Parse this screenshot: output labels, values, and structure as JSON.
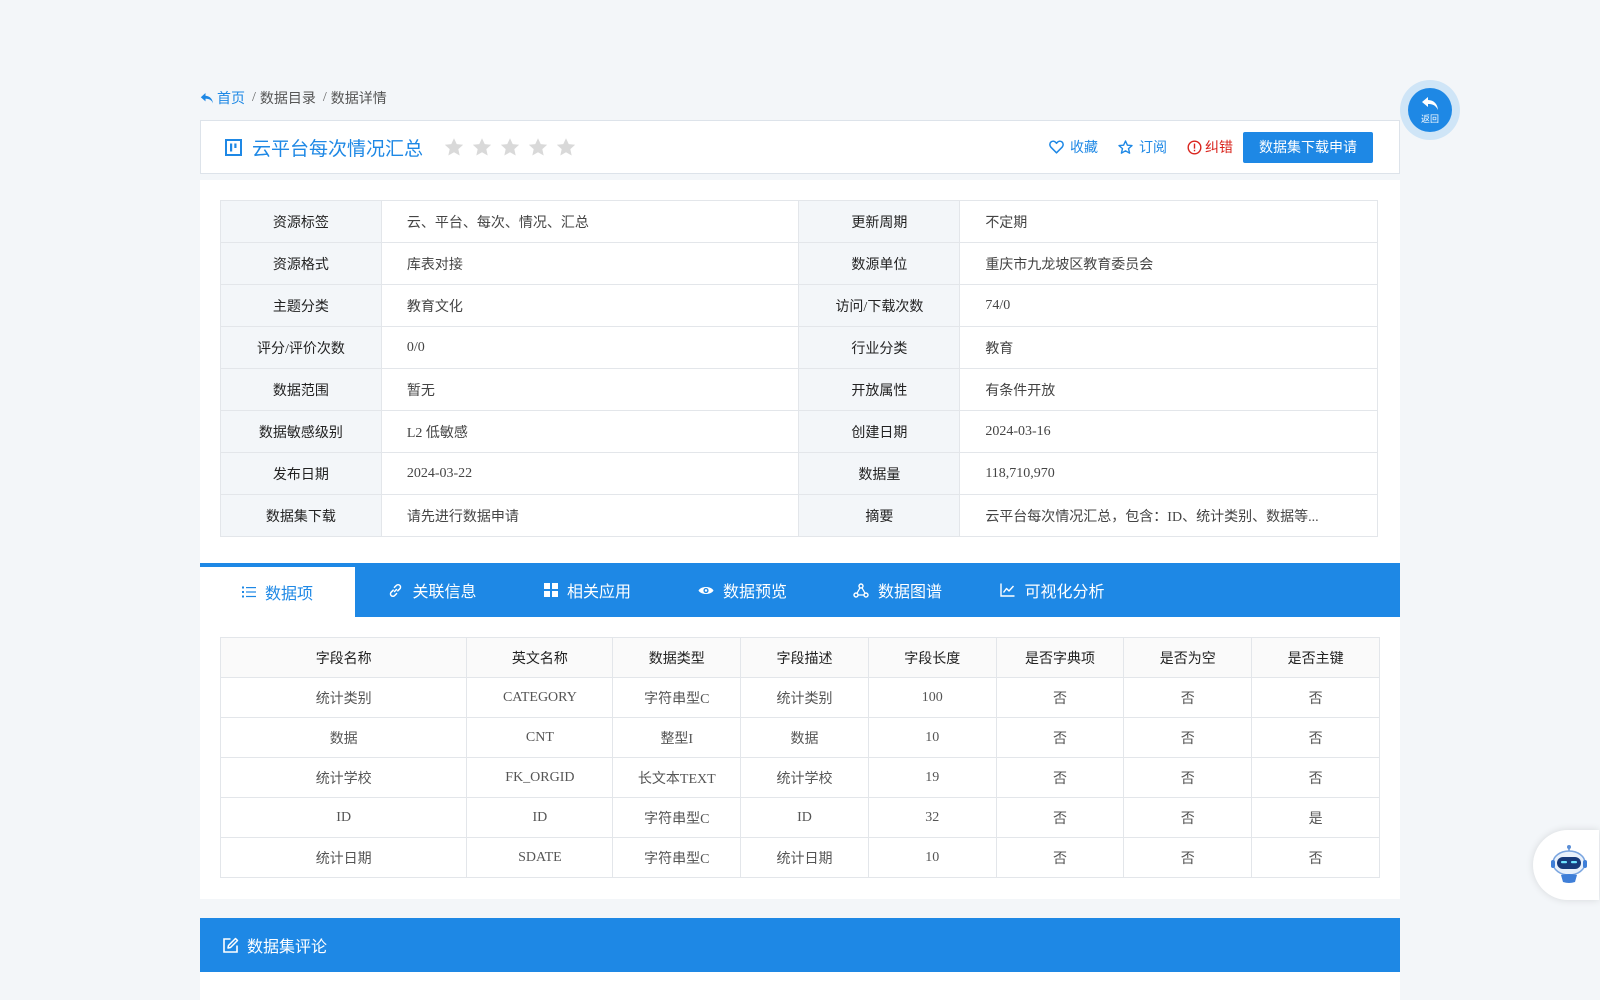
{
  "breadcrumb": {
    "home": "首页",
    "sep": "/",
    "items": [
      "数据目录",
      "数据详情"
    ]
  },
  "header": {
    "title": "云平台每次情况汇总",
    "rating": 0,
    "max_rating": 5,
    "actions": {
      "favorite": "收藏",
      "subscribe": "订阅",
      "report_error": "纠错",
      "apply_download": "数据集下载申请"
    }
  },
  "info": {
    "rows": [
      [
        {
          "label": "资源标签",
          "value": "云、平台、每次、情况、汇总"
        },
        {
          "label": "更新周期",
          "value": "不定期"
        }
      ],
      [
        {
          "label": "资源格式",
          "value": "库表对接"
        },
        {
          "label": "数源单位",
          "value": "重庆市九龙坡区教育委员会"
        }
      ],
      [
        {
          "label": "主题分类",
          "value": "教育文化"
        },
        {
          "label": "访问/下载次数",
          "value": "74/0"
        }
      ],
      [
        {
          "label": "评分/评价次数",
          "value": "0/0"
        },
        {
          "label": "行业分类",
          "value": "教育"
        }
      ],
      [
        {
          "label": "数据范围",
          "value": "暂无"
        },
        {
          "label": "开放属性",
          "value": "有条件开放"
        }
      ],
      [
        {
          "label": "数据敏感级别",
          "value": "L2 低敏感"
        },
        {
          "label": "创建日期",
          "value": "2024-03-16"
        }
      ],
      [
        {
          "label": "发布日期",
          "value": "2024-03-22"
        },
        {
          "label": "数据量",
          "value": "118,710,970"
        }
      ],
      [
        {
          "label": "数据集下载",
          "value": "请先进行数据申请"
        },
        {
          "label": "摘要",
          "value": "云平台每次情况汇总，包含：ID、统计类别、数据等..."
        }
      ]
    ]
  },
  "tabs": [
    {
      "label": "数据项",
      "icon": "list-icon",
      "active": true
    },
    {
      "label": "关联信息",
      "icon": "link-icon"
    },
    {
      "label": "相关应用",
      "icon": "grid-icon"
    },
    {
      "label": "数据预览",
      "icon": "eye-icon"
    },
    {
      "label": "数据图谱",
      "icon": "graph-icon"
    },
    {
      "label": "可视化分析",
      "icon": "chart-line-icon"
    }
  ],
  "fields": {
    "headers": [
      "字段名称",
      "英文名称",
      "数据类型",
      "字段描述",
      "字段长度",
      "是否字典项",
      "是否为空",
      "是否主键"
    ],
    "rows": [
      [
        "统计类别",
        "CATEGORY",
        "字符串型C",
        "统计类别",
        "100",
        "否",
        "否",
        "否"
      ],
      [
        "数据",
        "CNT",
        "整型I",
        "数据",
        "10",
        "否",
        "否",
        "否"
      ],
      [
        "统计学校",
        "FK_ORGID",
        "长文本TEXT",
        "统计学校",
        "19",
        "否",
        "否",
        "否"
      ],
      [
        "ID",
        "ID",
        "字符串型C",
        "ID",
        "32",
        "否",
        "否",
        "是"
      ],
      [
        "统计日期",
        "SDATE",
        "字符串型C",
        "统计日期",
        "10",
        "否",
        "否",
        "否"
      ]
    ]
  },
  "comments": {
    "title": "数据集评论"
  },
  "float": {
    "back_label": "返回"
  },
  "colors": {
    "primary": "#1e88e5",
    "error": "#d9241d",
    "page_bg": "#f3f6f9",
    "star_empty": "#d9d9d9"
  }
}
